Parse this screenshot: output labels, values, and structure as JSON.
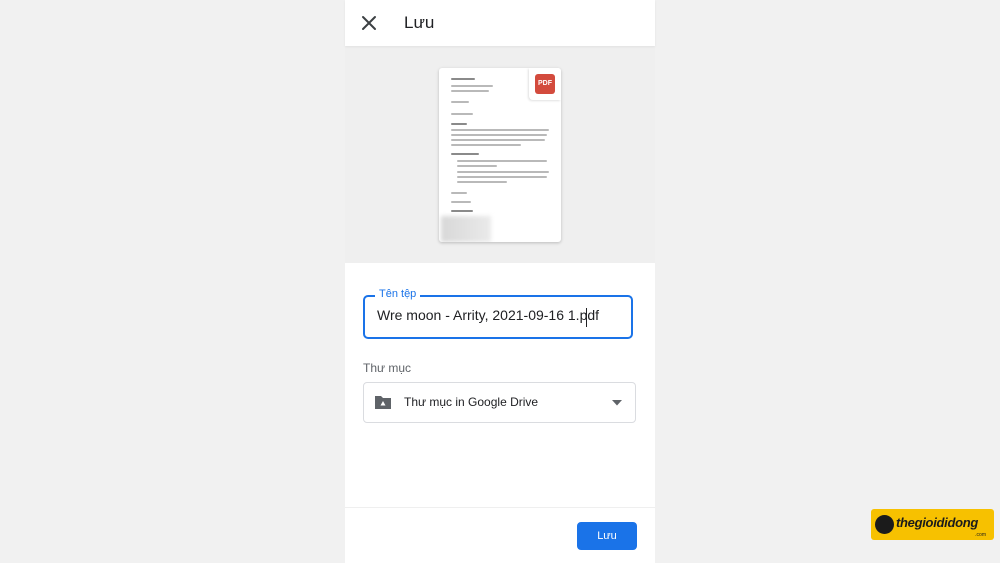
{
  "appbar": {
    "title": "Lưu",
    "close_icon": "close-icon"
  },
  "preview": {
    "badge": "PDF"
  },
  "form": {
    "filename_label": "Tên tệp",
    "filename_value": "Wre moon - Arrity, 2021-09-16 1.pdf",
    "folder_label": "Thư mục",
    "folder_value": "Thư mục in Google Drive"
  },
  "footer": {
    "save_label": "Lưu"
  },
  "brand": {
    "name": "thegioididong",
    "sub": ".com"
  },
  "colors": {
    "accent": "#1a73e8",
    "pdf_red": "#d34b3d",
    "brand_yellow": "#f7c100"
  }
}
